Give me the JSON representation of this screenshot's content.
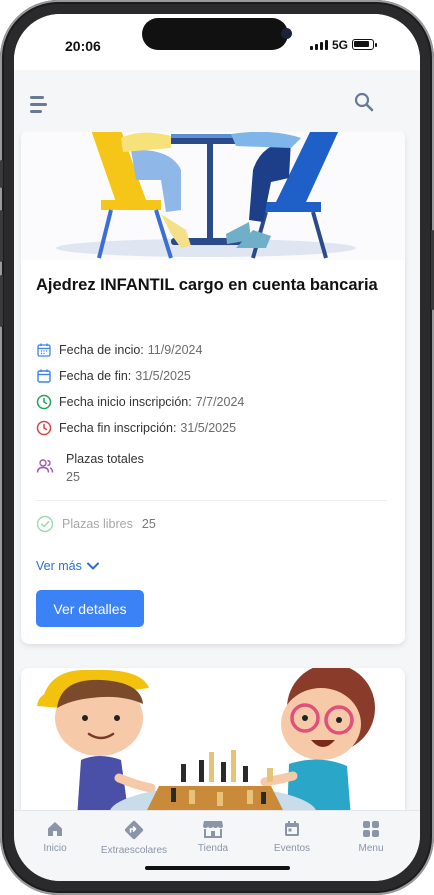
{
  "status_bar": {
    "time": "20:06",
    "network": "5G"
  },
  "header": {
    "menu_icon": "hamburger-menu-icon",
    "search_icon": "search-icon"
  },
  "activity": {
    "title": "Ajedrez INFANTIL cargo en cuenta bancaria",
    "fields": [
      {
        "label": "Fecha de incio:",
        "value": "11/9/2024",
        "icon": "calendar-icon"
      },
      {
        "label": "Fecha de fin:",
        "value": "31/5/2025",
        "icon": "calendar-icon"
      },
      {
        "label": "Fecha inicio inscripción:",
        "value": "7/7/2024",
        "icon": "clock-icon"
      },
      {
        "label": "Fecha fin inscripción:",
        "value": "31/5/2025",
        "icon": "clock-icon"
      }
    ],
    "plazas_totales": {
      "label": "Plazas totales",
      "value": "25"
    },
    "plazas_libres": {
      "label": "Plazas libres",
      "value": "25"
    },
    "ver_mas": "Ver más",
    "details_button": "Ver detalles"
  },
  "tabs": [
    {
      "label": "Inicio",
      "icon": "home-icon"
    },
    {
      "label": "Extraescolares",
      "icon": "directions-icon"
    },
    {
      "label": "Tienda",
      "icon": "store-icon"
    },
    {
      "label": "Eventos",
      "icon": "calendar-icon"
    },
    {
      "label": "Menu",
      "icon": "grid-icon"
    }
  ],
  "colors": {
    "accent": "#3b82f6",
    "link": "#2b6fd0",
    "green": "#22a35a",
    "red": "#d64545",
    "purple": "#9b59b6",
    "tab_icon": "#8a96a8"
  }
}
